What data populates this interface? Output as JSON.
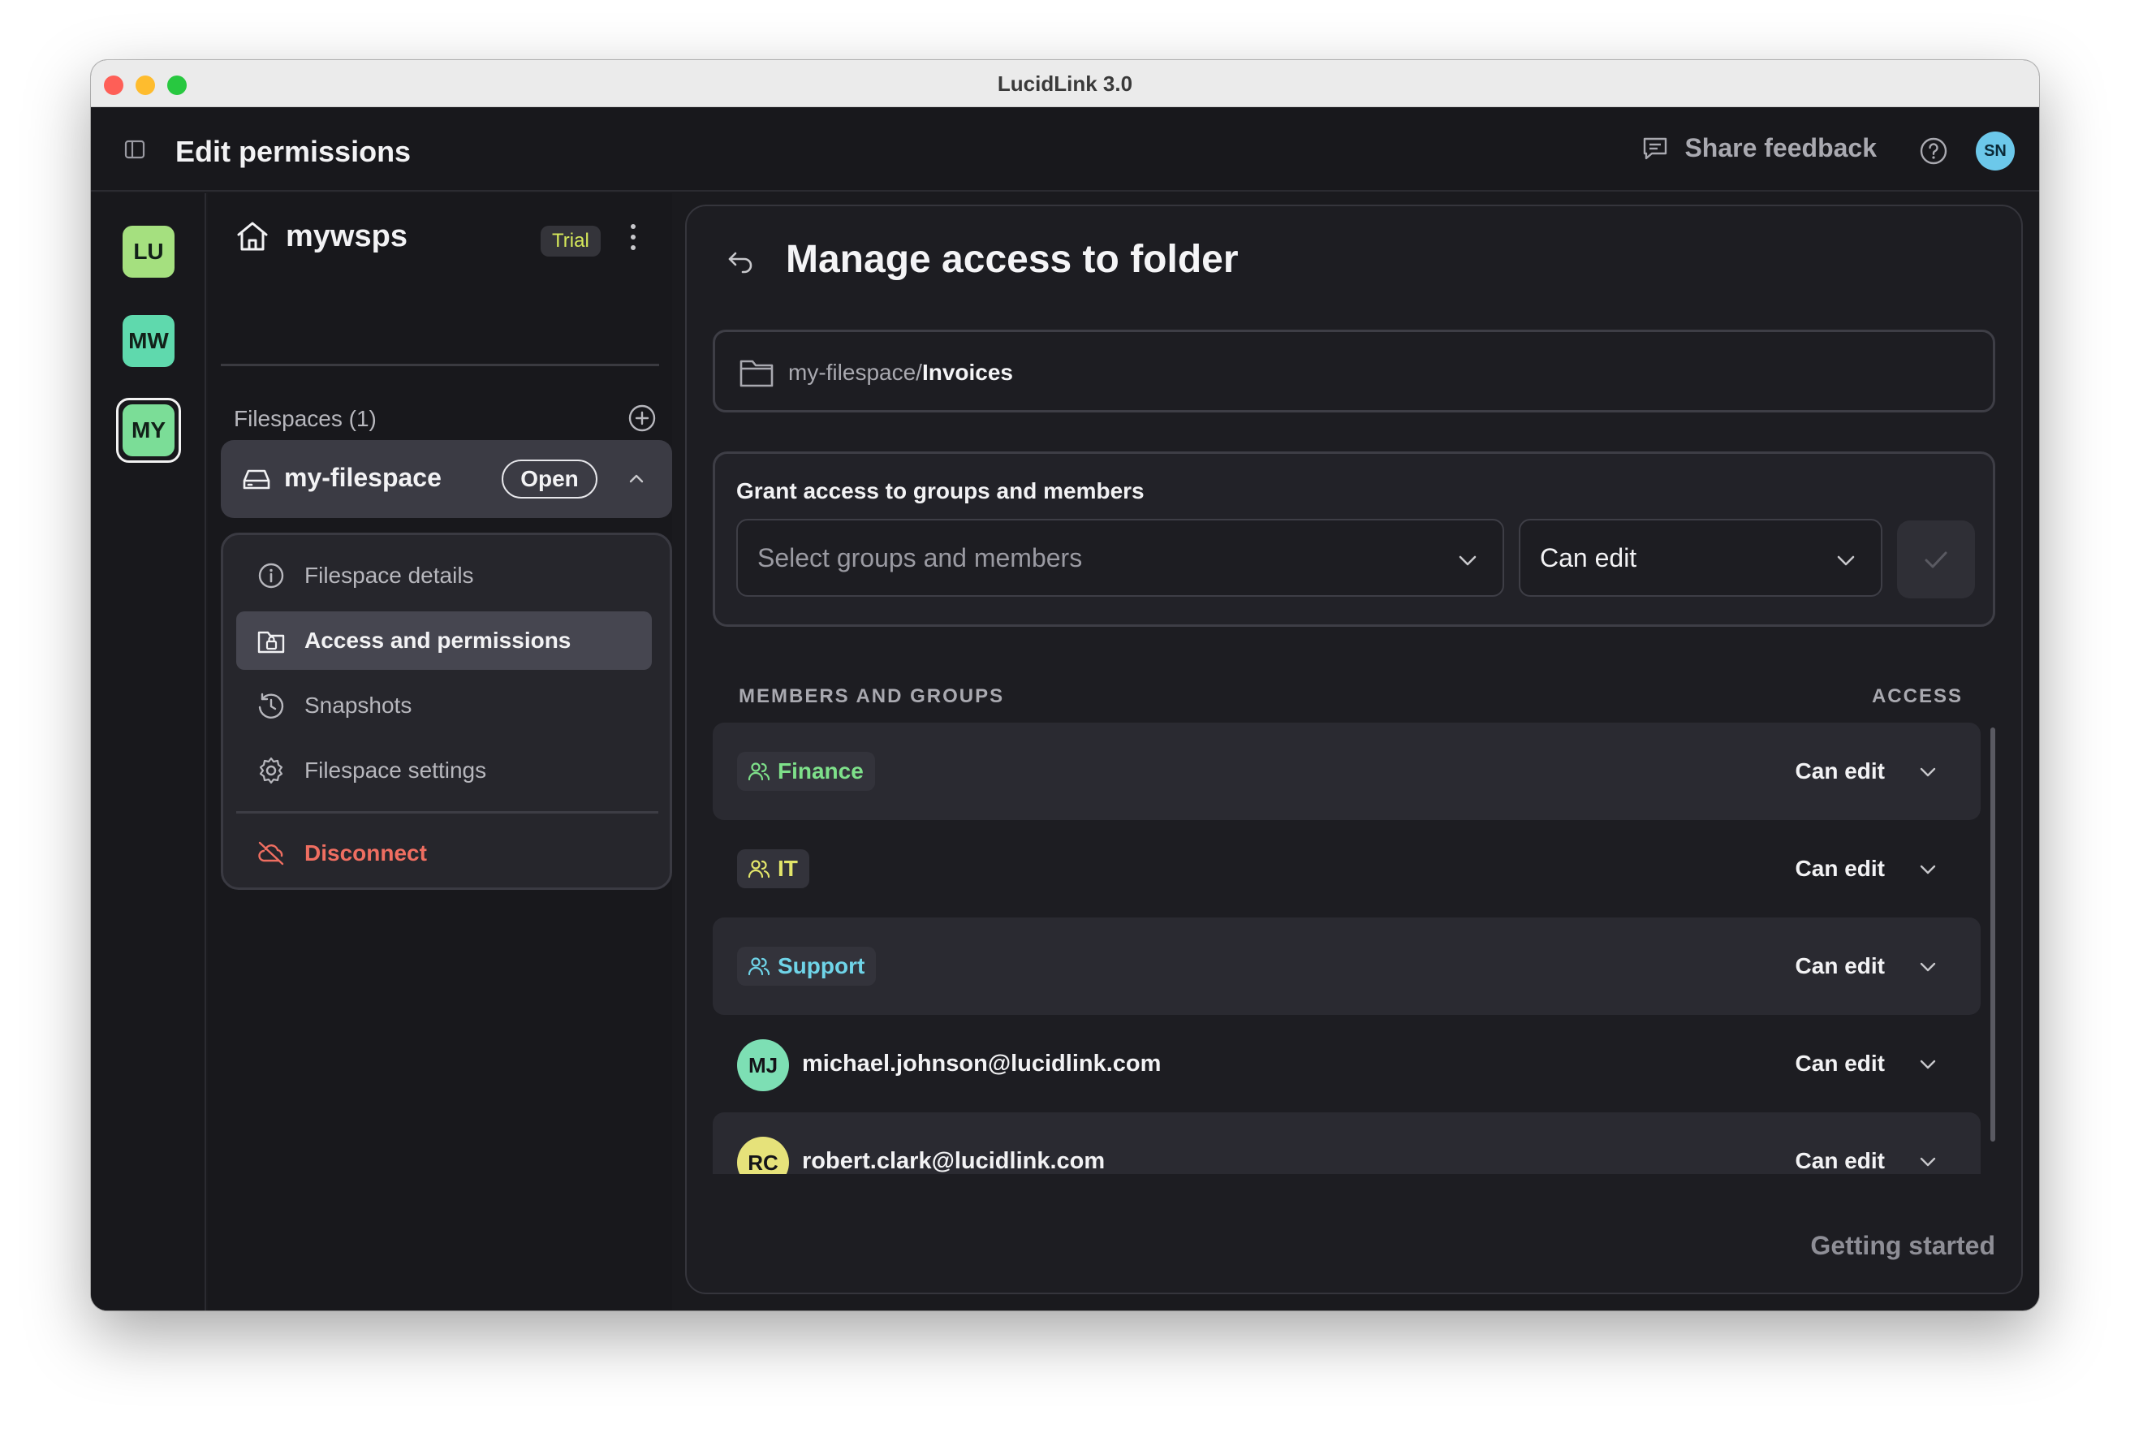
{
  "window": {
    "title": "LucidLink 3.0"
  },
  "appbar": {
    "title": "Edit permissions",
    "feedback_label": "Share feedback",
    "user_initials": "SN"
  },
  "rail": {
    "workspaces": [
      {
        "initials": "LU",
        "color": "#a5e07f"
      },
      {
        "initials": "MW",
        "color": "#5fd9ad"
      },
      {
        "initials": "MY",
        "color": "#7bdd97",
        "selected": true
      }
    ]
  },
  "panel": {
    "workspace_name": "mywsps",
    "trial_badge": "Trial",
    "filespaces_heading": "Filespaces (1)",
    "filespace": {
      "name": "my-filespace",
      "status": "Open"
    },
    "menu": [
      {
        "label": "Filespace details",
        "icon": "info-icon"
      },
      {
        "label": "Access and permissions",
        "icon": "folder-lock-icon",
        "active": true
      },
      {
        "label": "Snapshots",
        "icon": "history-icon"
      },
      {
        "label": "Filespace settings",
        "icon": "gear-icon"
      }
    ],
    "disconnect_label": "Disconnect"
  },
  "main": {
    "title": "Manage access to folder",
    "path_prefix": "my-filespace/",
    "path_folder": "Invoices",
    "grant": {
      "title": "Grant access to groups and members",
      "members_placeholder": "Select groups and members",
      "access_value": "Can edit"
    },
    "list": {
      "header_left": "MEMBERS AND GROUPS",
      "header_right": "ACCESS",
      "rows": [
        {
          "type": "group",
          "name": "Finance",
          "access": "Can edit",
          "color": "#7ee08a"
        },
        {
          "type": "group",
          "name": "IT",
          "access": "Can edit",
          "color": "#e2e56a"
        },
        {
          "type": "group",
          "name": "Support",
          "access": "Can edit",
          "color": "#6fd4e8"
        },
        {
          "type": "member",
          "initials": "MJ",
          "email": "michael.johnson@lucidlink.com",
          "access": "Can edit",
          "color": "#7ddfb4"
        },
        {
          "type": "member",
          "initials": "RC",
          "email": "robert.clark@lucidlink.com",
          "access": "Can edit",
          "color": "#e6e27a"
        }
      ]
    },
    "getting_started": "Getting started"
  }
}
